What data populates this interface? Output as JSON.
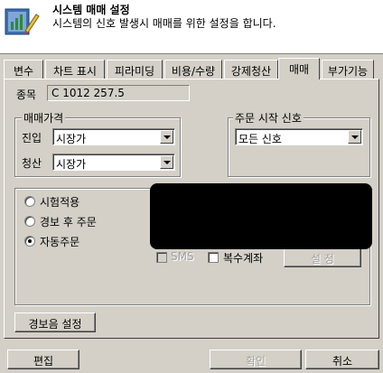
{
  "header": {
    "title": "시스템 매매 설정",
    "subtitle": "시스템의 신호 발생시 매매를 위한 설정을 합니다."
  },
  "tabs": [
    {
      "label": "변수"
    },
    {
      "label": "차트 표시"
    },
    {
      "label": "피라미딩"
    },
    {
      "label": "비용/수량"
    },
    {
      "label": "강제청산"
    },
    {
      "label": "매매"
    },
    {
      "label": "부가기능"
    }
  ],
  "symbol": {
    "label": "종목",
    "value": "C 1012 257.5"
  },
  "price_group": {
    "title": "매매가격",
    "entry_label": "진입",
    "entry_value": "시장가",
    "exit_label": "청산",
    "exit_value": "시장가"
  },
  "order_signal": {
    "title": "주문 시작 신호",
    "value": "모든 신호"
  },
  "mode": {
    "options": [
      {
        "label": "시험적용",
        "selected": false
      },
      {
        "label": "경보 후 주문",
        "selected": false
      },
      {
        "label": "자동주문",
        "selected": true
      }
    ]
  },
  "options": {
    "sms_label": "SMS",
    "multi_account_label": "복수계좌",
    "settings_button": "설 정"
  },
  "alert_button": "경보음 설정",
  "footer": {
    "edit": "편집",
    "confirm": "확인",
    "cancel": "취소"
  }
}
